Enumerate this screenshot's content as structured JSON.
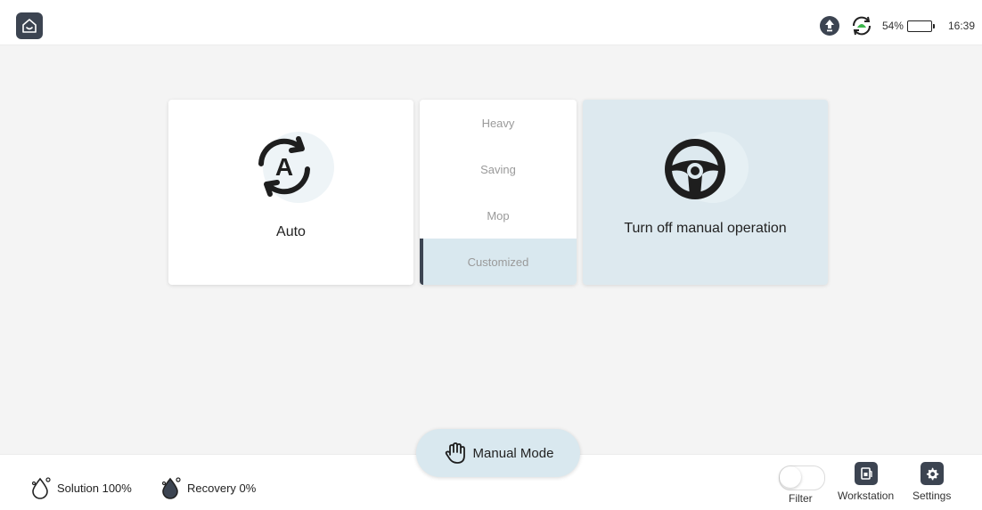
{
  "status": {
    "battery_percent": "54%",
    "time": "16:39"
  },
  "cards": {
    "auto_label": "Auto",
    "manual_label": "Turn off manual operation"
  },
  "modes": {
    "items": [
      "Heavy",
      "Saving",
      "Mop",
      "Customized"
    ],
    "selected": "Customized"
  },
  "manual_mode": {
    "label": "Manual Mode"
  },
  "tanks": {
    "solution": "Solution 100%",
    "recovery": "Recovery 0%"
  },
  "tools": {
    "filter_label": "Filter",
    "filter_on": false,
    "workstation_label": "Workstation",
    "settings_label": "Settings"
  },
  "colors": {
    "dark": "#3c4451",
    "accent_light": "#d9e8ef",
    "sync_green": "#3bb54a"
  },
  "icons": {
    "home": "home-icon",
    "upload": "upload-icon",
    "sync": "sync-icon",
    "battery": "battery-icon",
    "auto": "auto-mode-icon",
    "steering": "steering-wheel-icon",
    "hand": "hand-icon",
    "water_drop": "water-drop-icon",
    "workstation": "workstation-icon",
    "settings": "gear-icon"
  }
}
